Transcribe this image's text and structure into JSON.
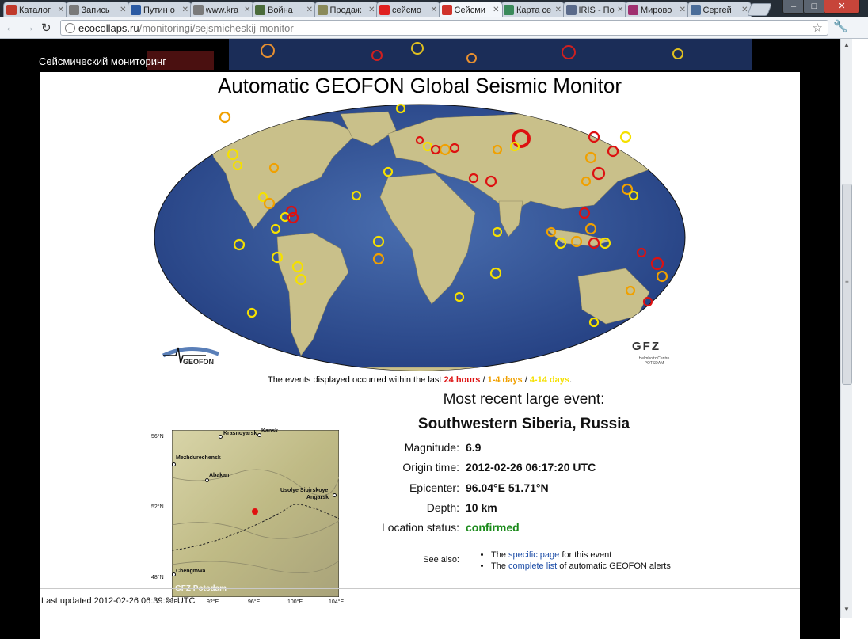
{
  "browser": {
    "tabs": [
      {
        "label": "Каталог",
        "icon": "catalog-favicon",
        "color": "#c0392b"
      },
      {
        "label": "Запись",
        "icon": "globe-favicon",
        "color": "#7a7a7a"
      },
      {
        "label": "Путин о",
        "icon": "monitor-favicon",
        "color": "#2b5aa3"
      },
      {
        "label": "www.kra",
        "icon": "globe-favicon",
        "color": "#7a7a7a"
      },
      {
        "label": "Война",
        "icon": "plane-favicon",
        "color": "#4a6b3a"
      },
      {
        "label": "Продаж",
        "icon": "document-favicon",
        "color": "#8a8a5a"
      },
      {
        "label": "сейсмо",
        "icon": "yandex-favicon",
        "color": "#e02020"
      },
      {
        "label": "Сейсми",
        "icon": "ecocollaps-favicon",
        "color": "#d0332b",
        "active": true
      },
      {
        "label": "Карта се",
        "icon": "map-favicon",
        "color": "#3a8a5a"
      },
      {
        "label": "IRIS - По",
        "icon": "iris-favicon",
        "color": "#5a6a8a"
      },
      {
        "label": "Мирово",
        "icon": "feather-favicon",
        "color": "#a03070"
      },
      {
        "label": "Сергей",
        "icon": "vk-favicon",
        "color": "#4a6d99"
      }
    ],
    "url_host": "ecocollaps.ru",
    "url_path": "/monitoringi/sejsmicheskij-monitor"
  },
  "page": {
    "title": "Сейсмический мониторинг"
  },
  "monitor": {
    "title": "Automatic GEOFON Global Seismic Monitor",
    "caption_prefix": "The events displayed occurred within the last",
    "legend_24h": "24 hours",
    "legend_sep1": "/",
    "legend_1_4": "1-4 days",
    "legend_sep2": "/",
    "legend_4_14": "4-14 days",
    "caption_suffix": ".",
    "legend_colors": {
      "h24": "#dd1111",
      "d1_4": "#f0a000",
      "d4_14": "#f5e000"
    },
    "logo_left": "GEOFON",
    "logo_right": "GFZ",
    "logo_right_sub1": "Helmholtz Centre",
    "logo_right_sub2": "POTSDAM"
  },
  "regional_map": {
    "lat_labels": [
      "56°N",
      "52°N",
      "48°N"
    ],
    "lon_labels": [
      "88°E",
      "92°E",
      "96°E",
      "100°E",
      "104°E"
    ],
    "cities": [
      "Krasnoyarsk",
      "Kansk",
      "Mezhdurechensk",
      "Abakan",
      "Usolye Sibirskoye",
      "Angarsk",
      "Chengmwa"
    ],
    "watermark": "GFZ Potsdam"
  },
  "event": {
    "heading": "Most recent large event:",
    "region": "Southwestern Siberia, Russia",
    "magnitude_label": "Magnitude:",
    "magnitude": "6.9",
    "origin_label": "Origin time:",
    "origin": "2012-02-26 06:17:20 UTC",
    "epicenter_label": "Epicenter:",
    "epicenter": "96.04°E 51.71°N",
    "depth_label": "Depth:",
    "depth": "10 km",
    "status_label": "Location status:",
    "status": "confirmed",
    "status_color": "#1a8a1a"
  },
  "see_also": {
    "label": "See also:",
    "item1_pre": "The",
    "item1_link": "specific page",
    "item1_post": "for this event",
    "item2_pre": "The",
    "item2_link": "complete list",
    "item2_post": "of automatic GEOFON alerts"
  },
  "footer": {
    "last_updated": "Last updated 2012-02-26 06:39:01 UTC"
  }
}
